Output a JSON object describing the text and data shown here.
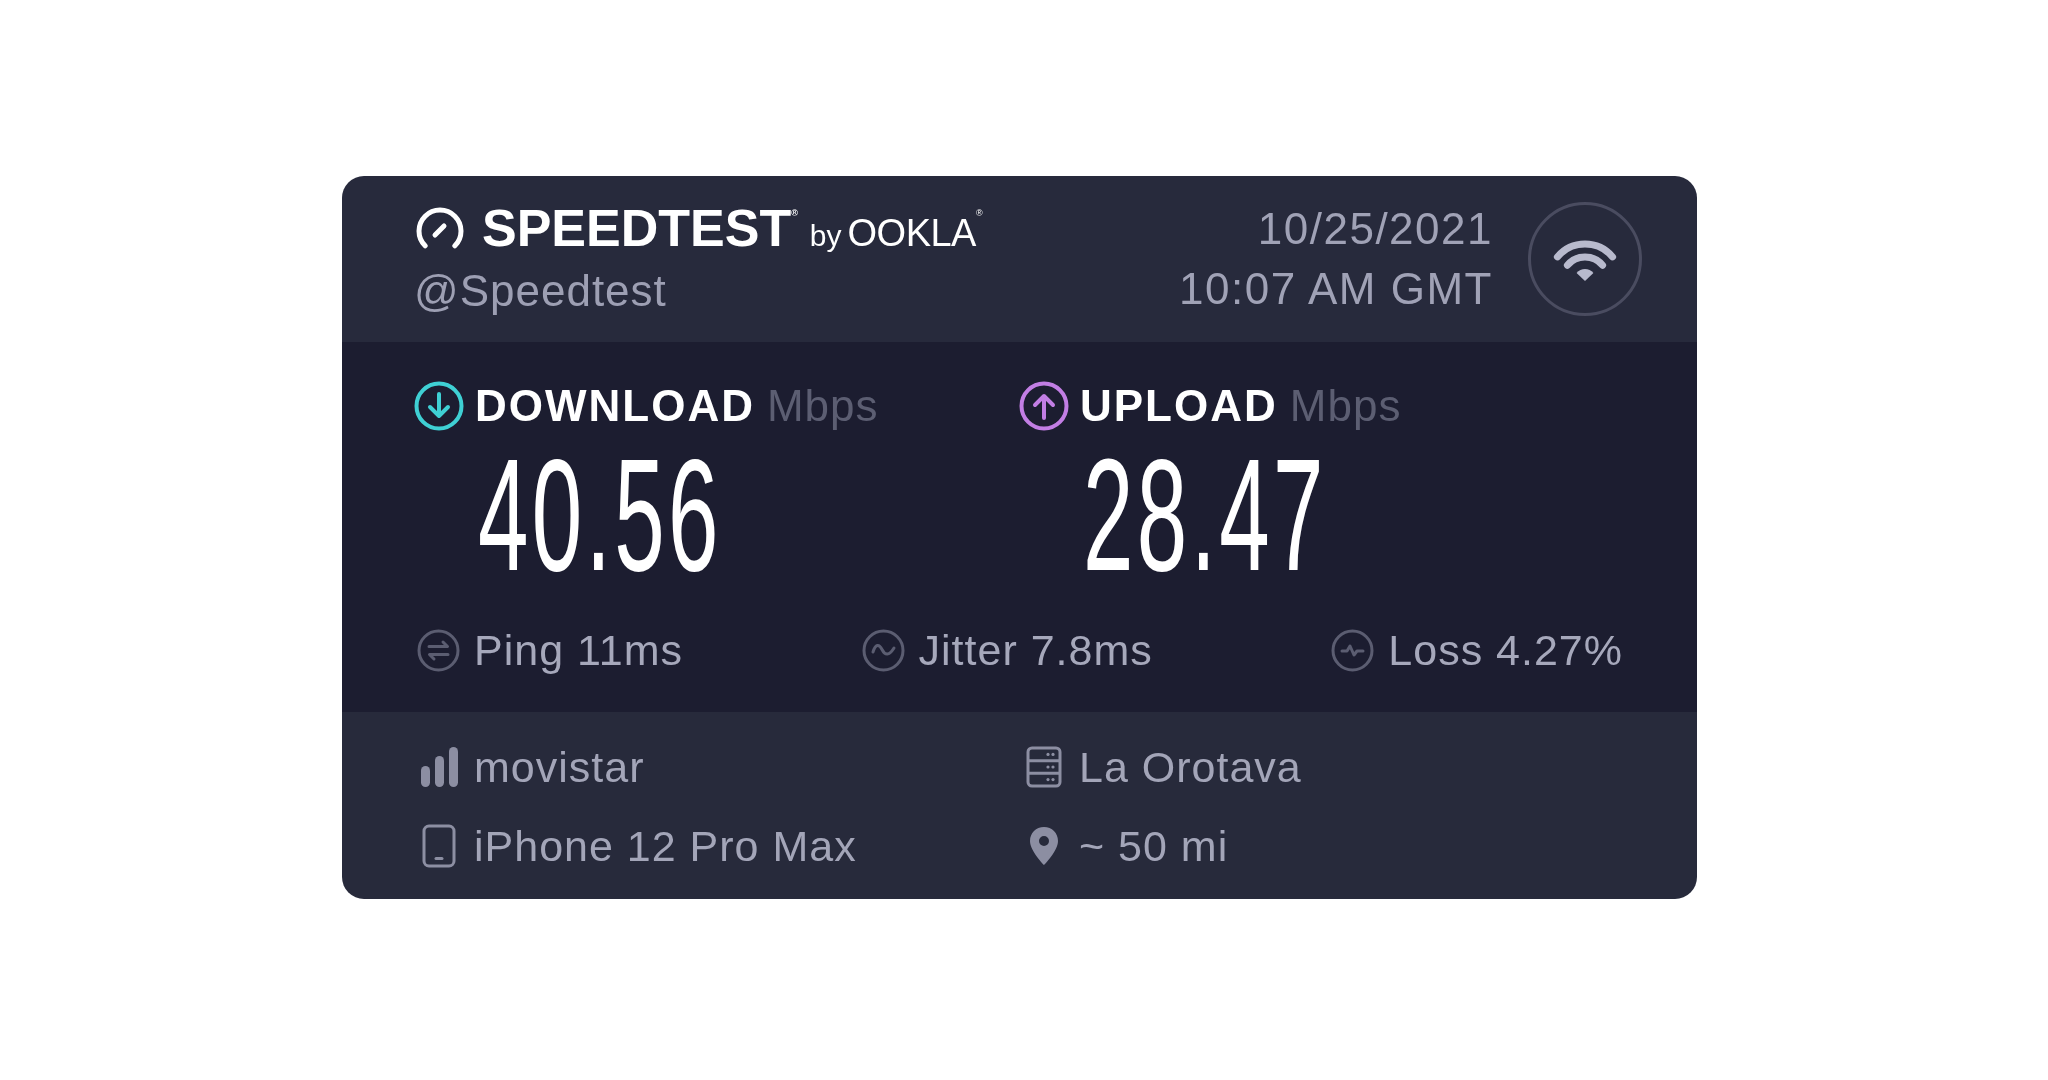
{
  "header": {
    "logo": {
      "name": "SPEEDTEST$^{®}$",
      "by": "by",
      "company": "OOKLA$^{®}$"
    },
    "handle": "@Speedtest",
    "date": "10/25/2021",
    "time": "10:07 AM GMT"
  },
  "results": [
    {
      "kind": "download",
      "label": "DOWNLOAD",
      "unit": "Mbps",
      "value": "40.56",
      "color": "#3fd0d4"
    },
    {
      "kind": "upload",
      "label": "UPLOAD",
      "unit": "Mbps",
      "value": "28.47",
      "color": "#c27ee4"
    }
  ],
  "metrics": [
    {
      "kind": "ping",
      "text": "Ping 11ms"
    },
    {
      "kind": "jitter",
      "text": "Jitter 7.8ms"
    },
    {
      "kind": "loss",
      "text": "Loss 4.27%"
    }
  ],
  "details": [
    {
      "kind": "carrier",
      "text": "movistar"
    },
    {
      "kind": "server",
      "text": "La Orotava"
    },
    {
      "kind": "device",
      "text": "iPhone 12 Pro Max"
    },
    {
      "kind": "distance",
      "text": "~ 50 mi"
    }
  ]
}
